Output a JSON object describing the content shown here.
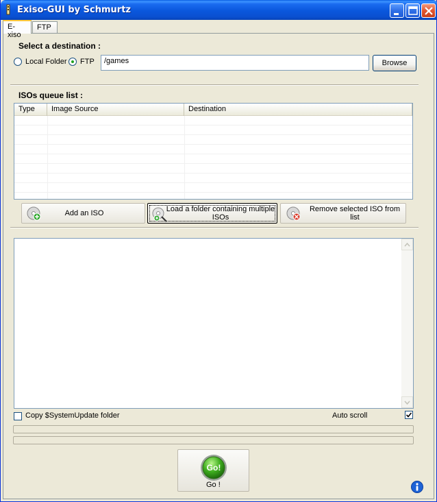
{
  "window": {
    "title": "Exiso-GUI by Schmurtz",
    "controls": [
      "minimize",
      "maximize",
      "close"
    ]
  },
  "tabs": [
    {
      "label": "E-xiso",
      "active": true
    },
    {
      "label": "FTP",
      "active": false
    }
  ],
  "destination": {
    "heading": "Select a destination :",
    "options": [
      {
        "label": "Local Folder",
        "checked": false
      },
      {
        "label": "FTP",
        "checked": true
      }
    ],
    "path_value": "/games",
    "browse_label": "Browse"
  },
  "queue": {
    "heading": "ISOs queue list :",
    "columns": [
      "Type",
      "Image Source",
      "Destination"
    ],
    "rows": []
  },
  "actions": {
    "add_iso": "Add an ISO",
    "load_folder": "Load a folder containing multiple ISOs",
    "remove_iso": "Remove selected ISO from list"
  },
  "log": {
    "content": ""
  },
  "options": {
    "copy_systemupdate": {
      "label": "Copy $SystemUpdate folder",
      "checked": false
    },
    "auto_scroll": {
      "label": "Auto scroll",
      "checked": true
    }
  },
  "progress": {
    "bar1": 0,
    "bar2": 0
  },
  "go": {
    "icon_text": "Go!",
    "label": "Go !"
  },
  "icons": {
    "app": "app-icon",
    "add": "disc-add-icon",
    "folder": "disc-search-icon",
    "remove": "disc-remove-icon",
    "info": "info-icon"
  }
}
